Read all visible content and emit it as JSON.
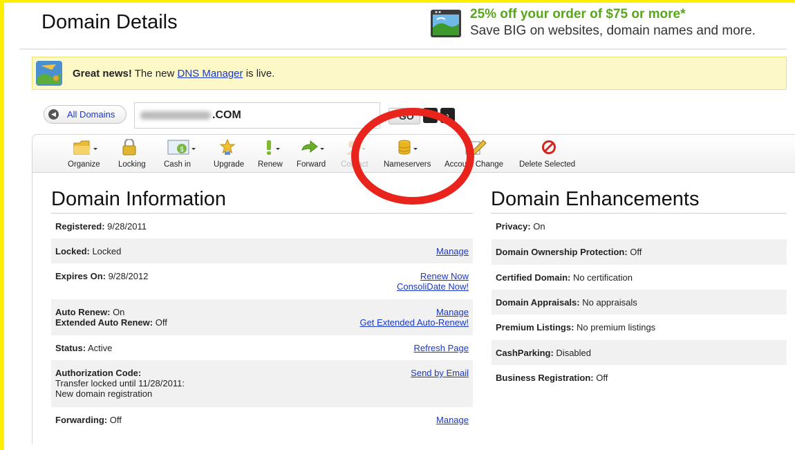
{
  "page": {
    "title": "Domain Details"
  },
  "promo": {
    "headline": "25% off your order of $75 or more*",
    "subline": "Save BIG on websites, domain names and more.",
    "icon": "globe-window-icon"
  },
  "notice": {
    "strong": "Great news!",
    "pre": " The new ",
    "link": "DNS Manager",
    "post": " is live.",
    "icon": "dns-map-icon"
  },
  "nav": {
    "all_domains_label": "All Domains",
    "domain_suffix": ".COM",
    "go_label": "GO",
    "prev_glyph": "‹",
    "next_glyph": "›"
  },
  "toolbar": {
    "items": [
      {
        "label": "Organize",
        "icon": "folder-icon"
      },
      {
        "label": "Locking",
        "icon": "lock-icon"
      },
      {
        "label": "Cash in",
        "icon": "cash-in-icon"
      },
      {
        "label": "Upgrade",
        "icon": "star-icon"
      },
      {
        "label": "Renew",
        "icon": "exclamation-icon"
      },
      {
        "label": "Forward",
        "icon": "arrow-right-icon"
      },
      {
        "label": "Contact",
        "icon": "contact-icon",
        "disabled": true
      },
      {
        "label": "Nameservers",
        "icon": "database-icon"
      },
      {
        "label": "Account Change",
        "icon": "pencil-icon"
      },
      {
        "label": "Delete Selected",
        "icon": "prohibit-icon"
      }
    ]
  },
  "domain_information": {
    "title": "Domain Information",
    "rows": [
      {
        "label": "Registered:",
        "value": " 9/28/2011"
      },
      {
        "label": "Locked:",
        "value": " Locked",
        "link": "Manage"
      },
      {
        "label": "Expires On:",
        "value": " 9/28/2012",
        "links": [
          "Renew Now",
          "ConsoliDate Now!"
        ]
      },
      {
        "label": "Auto Renew:",
        "value": " On",
        "label2": "Extended Auto Renew:",
        "value2": " Off",
        "links": [
          "Manage",
          "Get Extended Auto-Renew!"
        ]
      },
      {
        "label": "Status:",
        "value": " Active",
        "link": "Refresh Page"
      },
      {
        "label": "Authorization Code:",
        "line2": "Transfer locked until 11/28/2011:",
        "line3": "New domain registration",
        "link": "Send by Email"
      },
      {
        "label": "Forwarding:",
        "value": " Off",
        "link": "Manage"
      }
    ]
  },
  "domain_enhancements": {
    "title": "Domain Enhancements",
    "rows": [
      {
        "label": "Privacy:",
        "value": " On"
      },
      {
        "label": "Domain Ownership Protection:",
        "value": " Off"
      },
      {
        "label": "Certified Domain:",
        "value": " No certification"
      },
      {
        "label": "Domain Appraisals:",
        "value": " No appraisals"
      },
      {
        "label": "Premium Listings:",
        "value": " No premium listings"
      },
      {
        "label": "CashParking:",
        "value": " Disabled"
      },
      {
        "label": "Business Registration:",
        "value": " Off"
      }
    ]
  },
  "colors": {
    "promo_green": "#5aa51e",
    "link_blue": "#1a37c4",
    "annotation_red": "#e8241c",
    "frame_yellow": "#ffee00"
  }
}
